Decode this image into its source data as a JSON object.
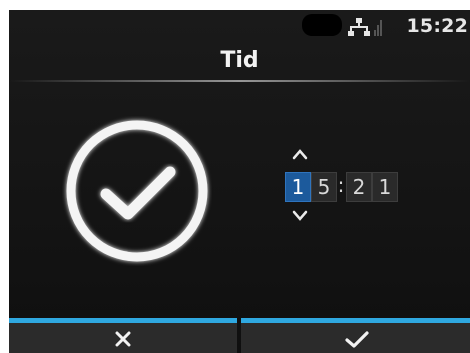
{
  "status_bar": {
    "time": "15:22",
    "icons": [
      "network-icon",
      "signal-icon"
    ]
  },
  "header": {
    "title": "Tid"
  },
  "time_editor": {
    "digits": [
      "1",
      "5",
      "2",
      "1"
    ],
    "separator": ":",
    "selected_digit_index": 0,
    "accent_color": "#1c5a9c"
  },
  "buttons": {
    "cancel_icon": "close-icon",
    "confirm_icon": "checkmark-icon",
    "bar_color": "#2fa8e0"
  },
  "main_icon": "clock-check-icon"
}
